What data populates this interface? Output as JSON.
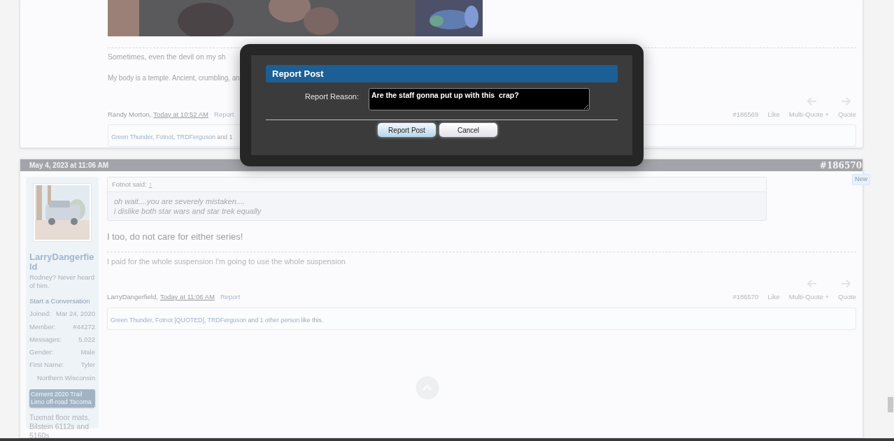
{
  "previous_post": {
    "image": {
      "kind": "picture"
    },
    "signature": [
      "Sometimes, even the devil on my sh",
      "My body is a temple. Ancient, crumbling, an"
    ],
    "author": "Randy Morton,",
    "time": "Today at 10:52 AM",
    "report": "Report",
    "number": "#186569",
    "actions": [
      "Like",
      "Multi-Quote +",
      "Quote"
    ],
    "likes": [
      {
        "text": "Green Thunder",
        "kind": "link"
      },
      {
        "text": ", ",
        "kind": "plain"
      },
      {
        "text": "Fotnot",
        "kind": "link"
      },
      {
        "text": ", ",
        "kind": "plain"
      },
      {
        "text": "TRDFerguson",
        "kind": "link"
      },
      {
        "text": " and 1",
        "kind": "plain"
      }
    ]
  },
  "post": {
    "date": "May 4, 2023 at 11:06 AM",
    "number": "#186570",
    "badge": "New",
    "user": {
      "name": "LarryDangerfield",
      "title": "Rodney? Never heard of him.",
      "start_conversation": "Start a Conversation",
      "stats": [
        {
          "label": "Joined:",
          "value": "Mar 24, 2020"
        },
        {
          "label": "Member:",
          "value": "#44272"
        },
        {
          "label": "Messages:",
          "value": "5,022"
        },
        {
          "label": "Gender:",
          "value": "Male"
        },
        {
          "label": "First Name:",
          "value": "Tyler"
        }
      ],
      "location": "Northern Wisconsin",
      "vehicle": "Cement 2020 Trail Limo off-road Tacoma",
      "mods": "Tuxmat floor mats, Bilstein 6112s and 5160s"
    },
    "quote": {
      "author": "Fotnot said:",
      "jump": "↑",
      "lines": [
        "oh wait....you are severely mistaken....",
        "i dislike both star wars and star trek equally"
      ]
    },
    "message": "I too, do not care for either series!",
    "signature": "I paid for the whole suspension I'm going to use the whole suspension",
    "author": "LarryDangerfield,",
    "time": "Today at 11:06 AM",
    "report": "Report",
    "footer_number": "#186570",
    "actions": [
      "Like",
      "Multi-Quote +",
      "Quote"
    ],
    "likes": [
      {
        "text": "Green Thunder",
        "kind": "link"
      },
      {
        "text": ", ",
        "kind": "plain"
      },
      {
        "text": "Fotnot [QUOTED]",
        "kind": "link"
      },
      {
        "text": ", ",
        "kind": "plain"
      },
      {
        "text": "TRDFerguson",
        "kind": "link"
      },
      {
        "text": " and ",
        "kind": "plain"
      },
      {
        "text": "1 other person",
        "kind": "link"
      },
      {
        "text": " like this.",
        "kind": "plain"
      }
    ]
  },
  "dialog": {
    "title": "Report Post",
    "label": "Report Reason:",
    "value": "Are the staff gonna put up with this  crap?",
    "buttons": [
      {
        "label": "Report Post",
        "kind": "primary"
      },
      {
        "label": "Cancel",
        "kind": "secondary"
      }
    ]
  }
}
